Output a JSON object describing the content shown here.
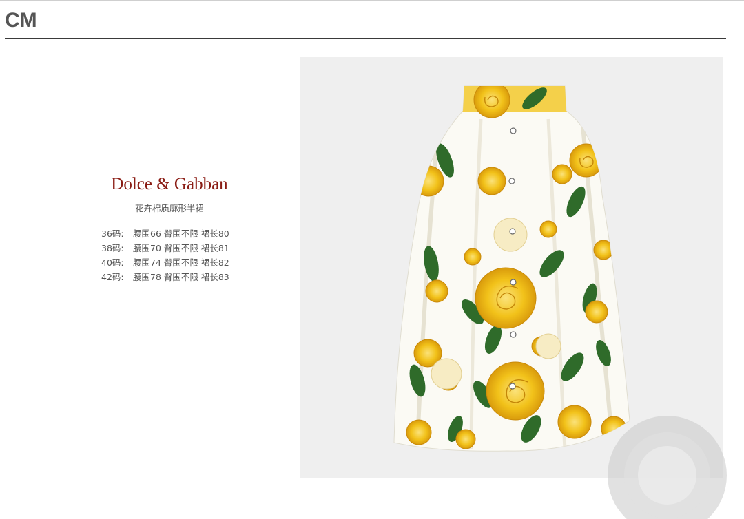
{
  "header": {
    "title": "CM"
  },
  "product": {
    "brand": "Dolce & Gabban",
    "name": "花卉棉质廓形半裙",
    "sizes": [
      {
        "size": "36码:",
        "detail": "腰围66 臀围不限 裙长80"
      },
      {
        "size": "38码:",
        "detail": "腰围70 臀围不限 裙长81"
      },
      {
        "size": "40码:",
        "detail": "腰围74 臀围不限 裙长82"
      },
      {
        "size": "42码:",
        "detail": "腰围78 臀围不限 裙长83"
      }
    ]
  },
  "colors": {
    "brand_text": "#8a1c14",
    "body_text": "#555555",
    "panel_bg": "#efefef",
    "rose_yellow": "#f2c21a",
    "leaf_green": "#2f6b2a"
  }
}
